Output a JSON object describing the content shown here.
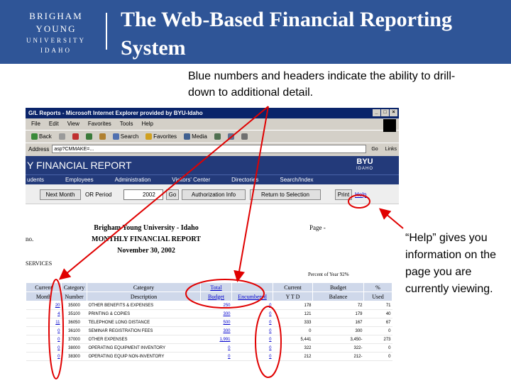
{
  "header": {
    "logo": {
      "line1": "BRIGHAM YOUNG",
      "line2": "UNIVERSITY",
      "line3": "IDAHO"
    },
    "title": "The Web-Based Financial Reporting System"
  },
  "callouts": {
    "drilldown": "Blue numbers and headers indicate the ability to drill-down to additional detail.",
    "help": "“Help” gives you information on the page you are currently viewing."
  },
  "browser": {
    "title": "G/L Reports - Microsoft Internet Explorer provided by BYU-Idaho",
    "menu": [
      "File",
      "Edit",
      "View",
      "Favorites",
      "Tools",
      "Help"
    ],
    "toolbar": [
      "Back",
      "Search",
      "Favorites",
      "Media"
    ],
    "address_label": "Address",
    "address": "asp?CMMAKE=...",
    "go": "Go",
    "links": "Links"
  },
  "report_page": {
    "banner_title": "Y FINANCIAL REPORT",
    "byu_mark": {
      "line1": "BYU",
      "line2": "IDAHO"
    },
    "nav": [
      "udents",
      "Employees",
      "Administration",
      "Visitors' Center",
      "Directories",
      "Search/Index"
    ],
    "controls": {
      "next_month": "Next Month",
      "or_period": "OR Period",
      "period_value": "2002",
      "go": "Go",
      "authorization_info": "Authorization Info",
      "return_selection": "Return to Selection",
      "print": "Print",
      "help": "Help"
    },
    "heading": {
      "institution": "Brigham Young University - Idaho",
      "report": "MONTHLY FINANCIAL REPORT",
      "date": "November 30, 2002",
      "page_of": "Page -",
      "acct": "no.",
      "services": "SERVICES",
      "percent_year": "Percent of Year 92%"
    },
    "table": {
      "head1": [
        "Current",
        "Category",
        "Category",
        "Total",
        "",
        "Current",
        "Budget",
        "%"
      ],
      "head2": [
        "Month",
        "Number",
        "Description",
        "Budget",
        "Encumbered",
        "Y T D",
        "Balance",
        "Used"
      ],
      "rows": [
        [
          "20",
          "35000",
          "OTHER BENEFITS & EXPENSES",
          "250",
          "0",
          "178",
          "72",
          "71"
        ],
        [
          "4",
          "35100",
          "PRINTING & COPIES",
          "300",
          "0",
          "121",
          "179",
          "40"
        ],
        [
          "11",
          "36050",
          "TELEPHONE LONG DISTANCE",
          "500",
          "0",
          "333",
          "167",
          "67"
        ],
        [
          "0",
          "36100",
          "SEMINAR REGISTRATION FEES",
          "300",
          "0",
          "0",
          "300",
          "0"
        ],
        [
          "0",
          "37000",
          "OTHER EXPENSES",
          "1,991",
          "0",
          "5,441",
          "3,450-",
          "273"
        ],
        [
          "0",
          "38000",
          "OPERATING EQUIPMENT INVENTORY",
          "0",
          "0",
          "322",
          "322-",
          "0"
        ],
        [
          "0",
          "38300",
          "OPERATING EQUIP NON-INVENTORY",
          "0",
          "0",
          "212",
          "212-",
          "0"
        ]
      ]
    }
  },
  "colors": {
    "header_bg": "#2f5597",
    "annotation_red": "#e00000",
    "drilldown_blue": "#0000cc",
    "table_header_bg": "#cfd8ea"
  }
}
